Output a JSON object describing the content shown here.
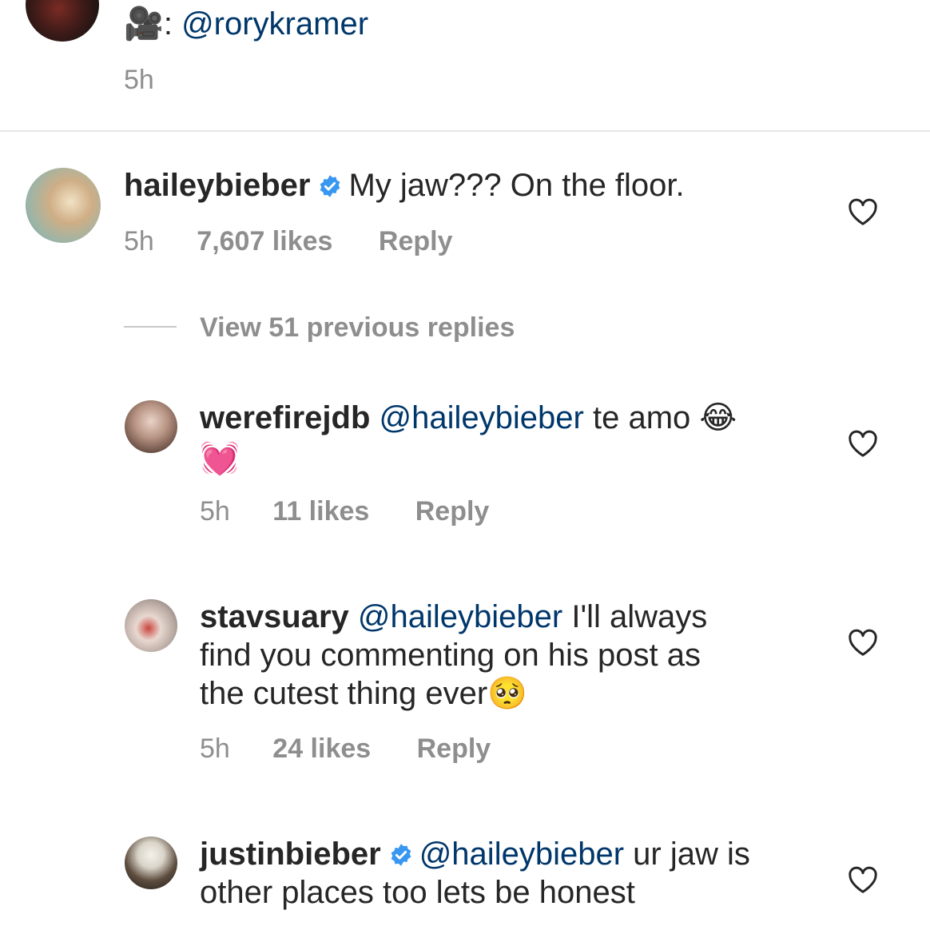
{
  "caption": {
    "camera_emoji": "🎥",
    "credit_prefix": ":",
    "credit_mention": "@rorykramer",
    "time": "5h"
  },
  "comments": [
    {
      "username": "haileybieber",
      "verified": true,
      "text": "My jaw??? On the floor.",
      "time": "5h",
      "likes": "7,607 likes",
      "reply": "Reply",
      "view_replies": "View 51 previous replies"
    },
    {
      "username": "werefirejdb",
      "mention": "@haileybieber",
      "text": "te amo",
      "emoji_1": "😂",
      "emoji_2": "💓",
      "time": "5h",
      "likes": "11 likes",
      "reply": "Reply"
    },
    {
      "username": "stavsuary",
      "mention": "@haileybieber",
      "text_line1": "I'll always",
      "text_line2": "find you commenting on his post as",
      "text_line3": "the cutest thing ever",
      "emoji": "🥺",
      "time": "5h",
      "likes": "24 likes",
      "reply": "Reply"
    },
    {
      "username": "justinbieber",
      "verified": true,
      "mention": "@haileybieber",
      "text_line1": "ur jaw is",
      "text_line2": "other places too lets be honest"
    }
  ],
  "icons": {
    "like": "heart-outline-icon",
    "verified": "verified-badge-icon"
  },
  "colors": {
    "text": "#262626",
    "secondary": "#8e8e8e",
    "mention": "#00376b",
    "verified": "#3897f0"
  }
}
